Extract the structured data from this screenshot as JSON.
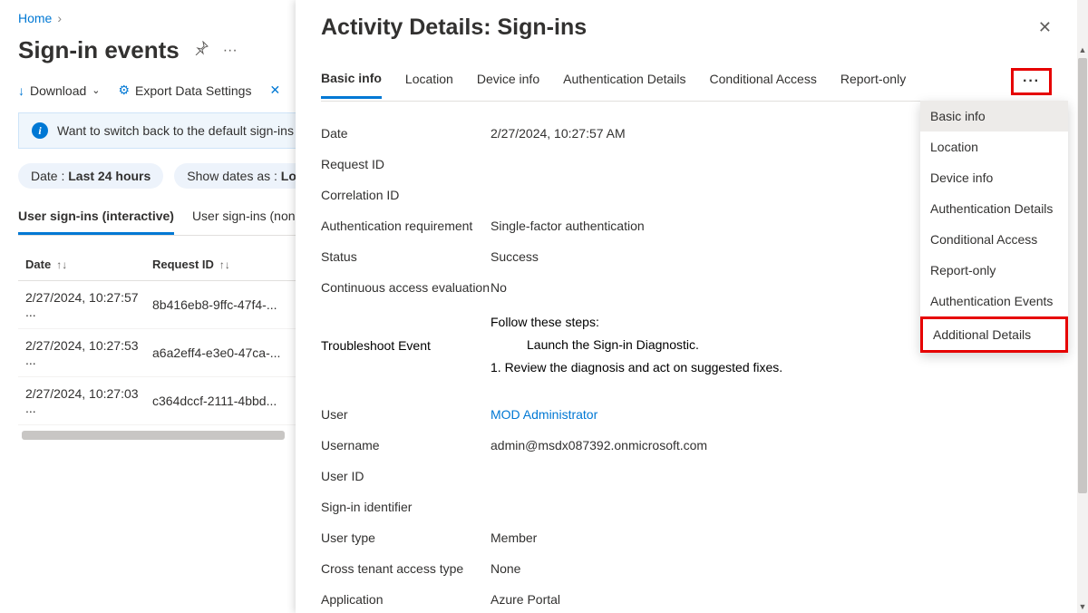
{
  "breadcrumb": {
    "home": "Home"
  },
  "page_title": "Sign-in events",
  "toolbar": {
    "download": "Download",
    "export": "Export Data Settings"
  },
  "banner": {
    "text": "Want to switch back to the default sign-ins experi"
  },
  "filters": {
    "date_label": "Date : ",
    "date_value": "Last 24 hours",
    "showdates_label": "Show dates as : ",
    "showdates_value": "Loca"
  },
  "bg_tabs": {
    "interactive": "User sign-ins (interactive)",
    "noninteractive": "User sign-ins (non"
  },
  "table_cols": {
    "date": "Date",
    "request": "Request ID"
  },
  "table_rows": [
    {
      "date": "2/27/2024, 10:27:57 ...",
      "req": "8b416eb8-9ffc-47f4-..."
    },
    {
      "date": "2/27/2024, 10:27:53 ...",
      "req": "a6a2eff4-e3e0-47ca-..."
    },
    {
      "date": "2/27/2024, 10:27:03 ...",
      "req": "c364dccf-2111-4bbd..."
    }
  ],
  "panel": {
    "title": "Activity Details: Sign-ins",
    "tabs": {
      "basic": "Basic info",
      "location": "Location",
      "device": "Device info",
      "auth": "Authentication Details",
      "ca": "Conditional Access",
      "report": "Report-only"
    },
    "details": {
      "date_l": "Date",
      "date_v": "2/27/2024, 10:27:57 AM",
      "req_l": "Request ID",
      "req_v": "",
      "corr_l": "Correlation ID",
      "corr_v": "",
      "authreq_l": "Authentication requirement",
      "authreq_v": "Single-factor authentication",
      "status_l": "Status",
      "status_v": "Success",
      "cae_l": "Continuous access evaluation",
      "cae_v": "No",
      "trouble_l": "Troubleshoot Event",
      "trouble_follow": "Follow these steps:",
      "trouble_link": "Launch the Sign-in Diagnostic.",
      "trouble_step1": "1. Review the diagnosis and act on suggested fixes.",
      "user_l": "User",
      "user_v": "MOD Administrator",
      "username_l": "Username",
      "username_v": "admin@msdx087392.onmicrosoft.com",
      "userid_l": "User ID",
      "userid_v": "",
      "signinid_l": "Sign-in identifier",
      "signinid_v": "",
      "usertype_l": "User type",
      "usertype_v": "Member",
      "crosstenant_l": "Cross tenant access type",
      "crosstenant_v": "None",
      "app_l": "Application",
      "app_v": "Azure Portal"
    }
  },
  "dropdown": {
    "basic": "Basic info",
    "location": "Location",
    "device": "Device info",
    "auth": "Authentication Details",
    "ca": "Conditional Access",
    "report": "Report-only",
    "authev": "Authentication Events",
    "addl": "Additional Details"
  }
}
